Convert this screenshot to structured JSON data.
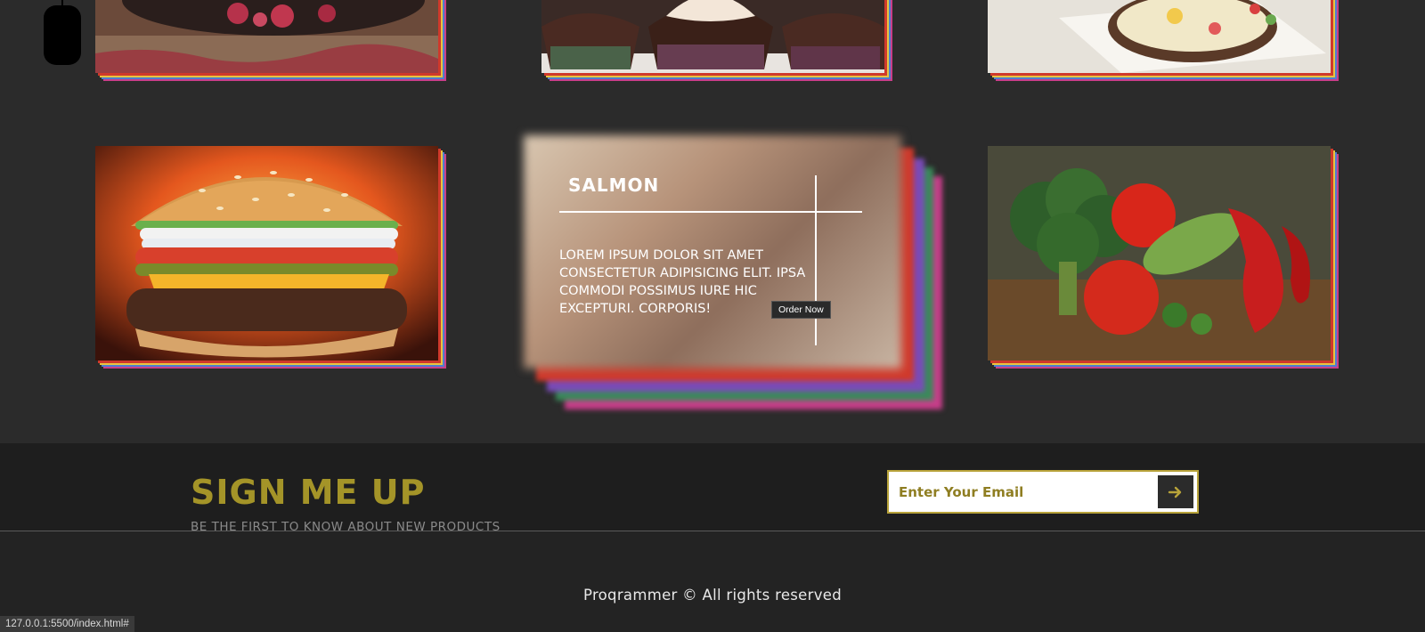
{
  "gallery": {
    "items": [
      {
        "name": "raspberry-dessert",
        "alt": "raspberry dessert"
      },
      {
        "name": "cupcakes",
        "alt": "cupcakes"
      },
      {
        "name": "sandwich",
        "alt": "open sandwich"
      },
      {
        "name": "burger",
        "alt": "burger"
      },
      {
        "name": "salmon",
        "alt": "salmon"
      },
      {
        "name": "vegetables",
        "alt": "vegetables"
      }
    ],
    "active_card": {
      "title": "SALMON",
      "text": "LOREM IPSUM DOLOR SIT AMET CONSECTETUR ADIPISICING ELIT. IPSA COMMODI POSSIMUS IURE HIC EXCEPTURI. CORPORIS!",
      "button_label": "Order Now"
    }
  },
  "signup": {
    "title": "SIGN ME UP",
    "subtitle": "BE THE FIRST TO KNOW ABOUT NEW PRODUCTS",
    "email_placeholder": "Enter Your Email"
  },
  "footer": {
    "text": "Proqrammer © All rights reserved"
  },
  "status_url": "127.0.0.1:5500/index.html#",
  "colors": {
    "background": "#2b2b2b",
    "accent_gold": "#a49428",
    "rainbow": [
      "#d0392b",
      "#e8c340",
      "#4e7fcf",
      "#c83e8a"
    ]
  },
  "icons": {
    "scroll": "mouse-icon",
    "submit": "arrow-right-icon"
  }
}
